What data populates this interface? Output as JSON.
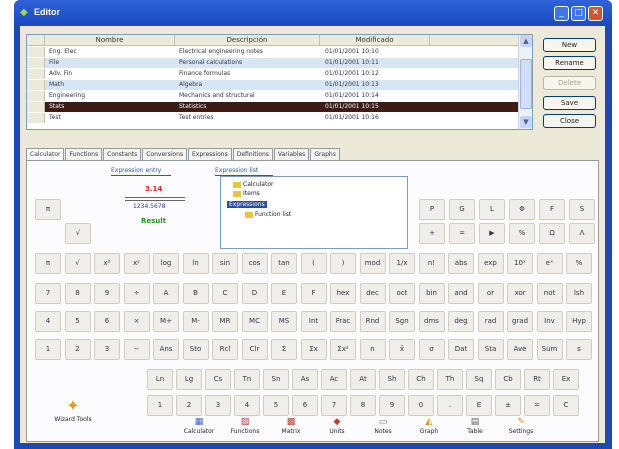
{
  "window": {
    "title": "Editor",
    "controls": {
      "minimize": "_",
      "maximize": "□",
      "close": "✕"
    }
  },
  "list": {
    "columns": [
      "Nombre",
      "Descripción",
      "Modificado"
    ],
    "rows": [
      {
        "name": "Eng. Elec",
        "desc": "Electrical engineering notes",
        "date": "01/01/2001 10:10"
      },
      {
        "name": "File",
        "desc": "Personal calculations",
        "date": "01/01/2001 10:11"
      },
      {
        "name": "Adv. Fin",
        "desc": "Finance formulas",
        "date": "01/01/2001 10:12"
      },
      {
        "name": "Math",
        "desc": "Algebra",
        "date": "01/01/2001 10:13"
      },
      {
        "name": "Engineering",
        "desc": "Mechanics and structural",
        "date": "01/01/2001 10:14"
      },
      {
        "name": "Stats",
        "desc": "Statistics",
        "date": "01/01/2001 10:15"
      },
      {
        "name": "Test",
        "desc": "Test entries",
        "date": "01/01/2001 10:16"
      }
    ],
    "selected_row": 5,
    "scroll_up": "▲",
    "scroll_down": "▼"
  },
  "buttons": [
    "New",
    "Rename",
    "Delete",
    "Save",
    "Close"
  ],
  "tabs": [
    "Calculator",
    "Functions",
    "Constants",
    "Conversions",
    "Expressions",
    "Definitions",
    "Variables",
    "Graphs"
  ],
  "expression": {
    "label": "Expression entry",
    "tree_label": "Expression list",
    "red_value": "3.14",
    "blue_value": "1234.5678",
    "green_value": "Result"
  },
  "tree": [
    "Calculator",
    "Items",
    "Expressions",
    "Function list"
  ],
  "key_rows": [
    [
      "π",
      "√",
      "x²",
      "xʸ",
      "log",
      "ln",
      "sin",
      "cos",
      "tan",
      "(",
      ")",
      "mod",
      "1/x",
      "n!",
      "abs",
      "exp",
      "10ˣ",
      "eˣ",
      "%"
    ],
    [
      "7",
      "8",
      "9",
      "÷",
      "A",
      "B",
      "C",
      "D",
      "E",
      "F",
      "hex",
      "dec",
      "oct",
      "bin",
      "and",
      "or",
      "xor",
      "not",
      "lsh"
    ],
    [
      "4",
      "5",
      "6",
      "×",
      "M+",
      "M-",
      "MR",
      "MC",
      "MS",
      "Int",
      "Frac",
      "Rnd",
      "Sgn",
      "dms",
      "deg",
      "rad",
      "grad",
      "Inv",
      "Hyp"
    ],
    [
      "1",
      "2",
      "3",
      "−",
      "Ans",
      "Sto",
      "Rcl",
      "Clr",
      "Σ",
      "Σx",
      "Σx²",
      "n",
      "x̄",
      "σ",
      "Dat",
      "Sta",
      "Ave",
      "Sum",
      "s"
    ]
  ],
  "side_keys": {
    "row1": [
      "P",
      "G",
      "L",
      "Φ",
      "F",
      "S"
    ],
    "row2": [
      "+",
      "=",
      "▶",
      "%",
      "Ω",
      "Λ"
    ]
  },
  "bottom_rows": [
    [
      "Ln",
      "Lg",
      "Cs",
      "Tn",
      "Sn",
      "As",
      "Ac",
      "At",
      "Sh",
      "Ch",
      "Th",
      "Sq",
      "Cb",
      "Rt",
      "Ex"
    ],
    [
      "1",
      "2",
      "3",
      "4",
      "5",
      "6",
      "7",
      "8",
      "9",
      "0",
      ".",
      "E",
      "±",
      "=",
      "C"
    ]
  ],
  "bottom_toolbar": [
    {
      "icon": "calculator-icon",
      "glyph": "▦",
      "label": "Calculator",
      "color": "#3a5fcd"
    },
    {
      "icon": "functions-icon",
      "glyph": "▨",
      "label": "Functions",
      "color": "#c23a2a"
    },
    {
      "icon": "matrix-icon",
      "glyph": "▩",
      "label": "Matrix",
      "color": "#c23a2a"
    },
    {
      "icon": "units-icon",
      "glyph": "◆",
      "label": "Units",
      "color": "#c23a2a"
    },
    {
      "icon": "document-icon",
      "glyph": "▭",
      "label": "Notes",
      "color": "#777777"
    },
    {
      "icon": "graph-icon",
      "glyph": "◭",
      "label": "Graph",
      "color": "#d89020"
    },
    {
      "icon": "table-icon",
      "glyph": "▤",
      "label": "Table",
      "color": "#5a5a5a"
    },
    {
      "icon": "settings-icon",
      "glyph": "✎",
      "label": "Settings",
      "color": "#d89020"
    }
  ],
  "app_icon_label": "Wizard Tools",
  "colors": {
    "titlebar": "#2f62d8",
    "selected_row": "#3c1c14",
    "alt_row": "#d6e6f4",
    "frame": "#1c49b8"
  }
}
